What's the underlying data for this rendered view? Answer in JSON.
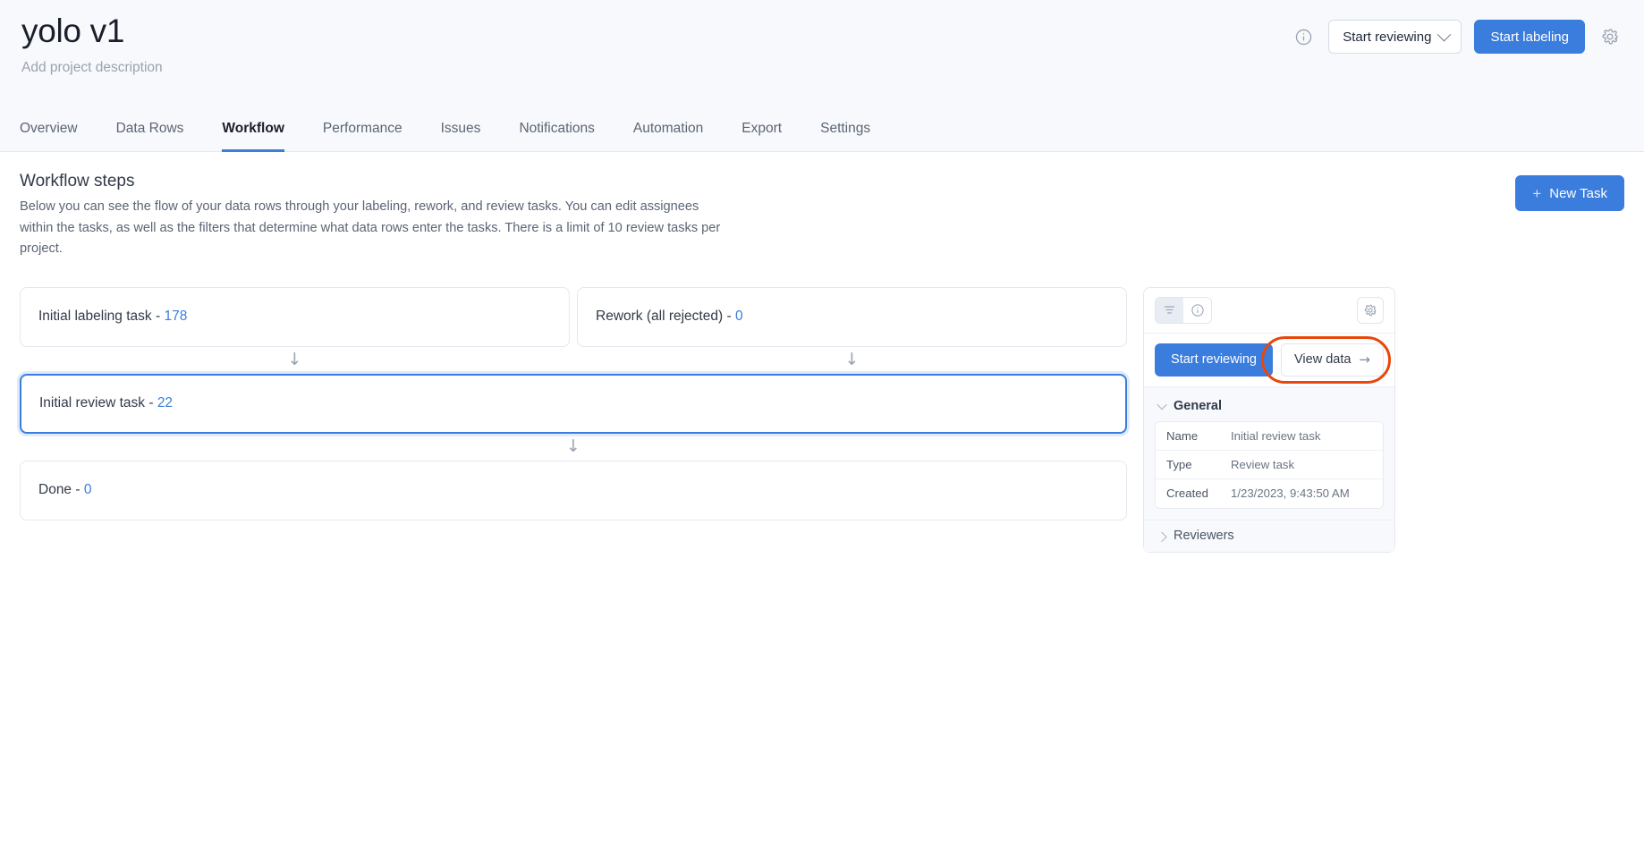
{
  "header": {
    "project_title": "yolo v1",
    "project_description": "Add project description",
    "info_icon": "info-circle-icon",
    "start_reviewing_label": "Start reviewing",
    "start_labeling_label": "Start labeling",
    "settings_icon": "gear-icon"
  },
  "tabs": [
    {
      "label": "Overview",
      "active": false
    },
    {
      "label": "Data Rows",
      "active": false
    },
    {
      "label": "Workflow",
      "active": true
    },
    {
      "label": "Performance",
      "active": false
    },
    {
      "label": "Issues",
      "active": false
    },
    {
      "label": "Notifications",
      "active": false
    },
    {
      "label": "Automation",
      "active": false
    },
    {
      "label": "Export",
      "active": false
    },
    {
      "label": "Settings",
      "active": false
    }
  ],
  "main": {
    "section_title": "Workflow steps",
    "section_description": "Below you can see the flow of your data rows through your labeling, rework, and review tasks. You can edit assignees within the tasks, as well as the filters that determine what data rows enter the tasks. There is a limit of 10 review tasks per project.",
    "new_task_label": "New Task",
    "new_task_plus": "+",
    "arrow_down_glyph": "↓"
  },
  "workflow_steps": [
    {
      "name": "Initial labeling task",
      "separator": "-",
      "count": "178",
      "selected": false
    },
    {
      "name": "Rework (all rejected)",
      "separator": "-",
      "count": "0",
      "selected": false
    },
    {
      "name": "Initial review task",
      "separator": "-",
      "count": "22",
      "selected": true
    },
    {
      "name": "Done",
      "separator": "-",
      "count": "0",
      "selected": false
    }
  ],
  "side_panel": {
    "toolbar": {
      "list_view_icon": "list-lines-icon",
      "info_view_icon": "info-circle-icon",
      "settings_icon": "gear-icon"
    },
    "start_reviewing_label": "Start reviewing",
    "view_data_label": "View data",
    "view_data_arrow": "→",
    "general": {
      "title": "General",
      "expanded": true,
      "rows": [
        {
          "key": "Name",
          "value": "Initial review task"
        },
        {
          "key": "Type",
          "value": "Review task"
        },
        {
          "key": "Created",
          "value": "1/23/2023, 9:43:50 AM"
        }
      ]
    },
    "reviewers": {
      "title": "Reviewers",
      "expanded": false
    }
  },
  "colors": {
    "accent_blue": "#3b7ddd",
    "annotation_orange": "#e8470a",
    "header_bg": "#f7f9fc",
    "border": "#e4e8ef"
  }
}
